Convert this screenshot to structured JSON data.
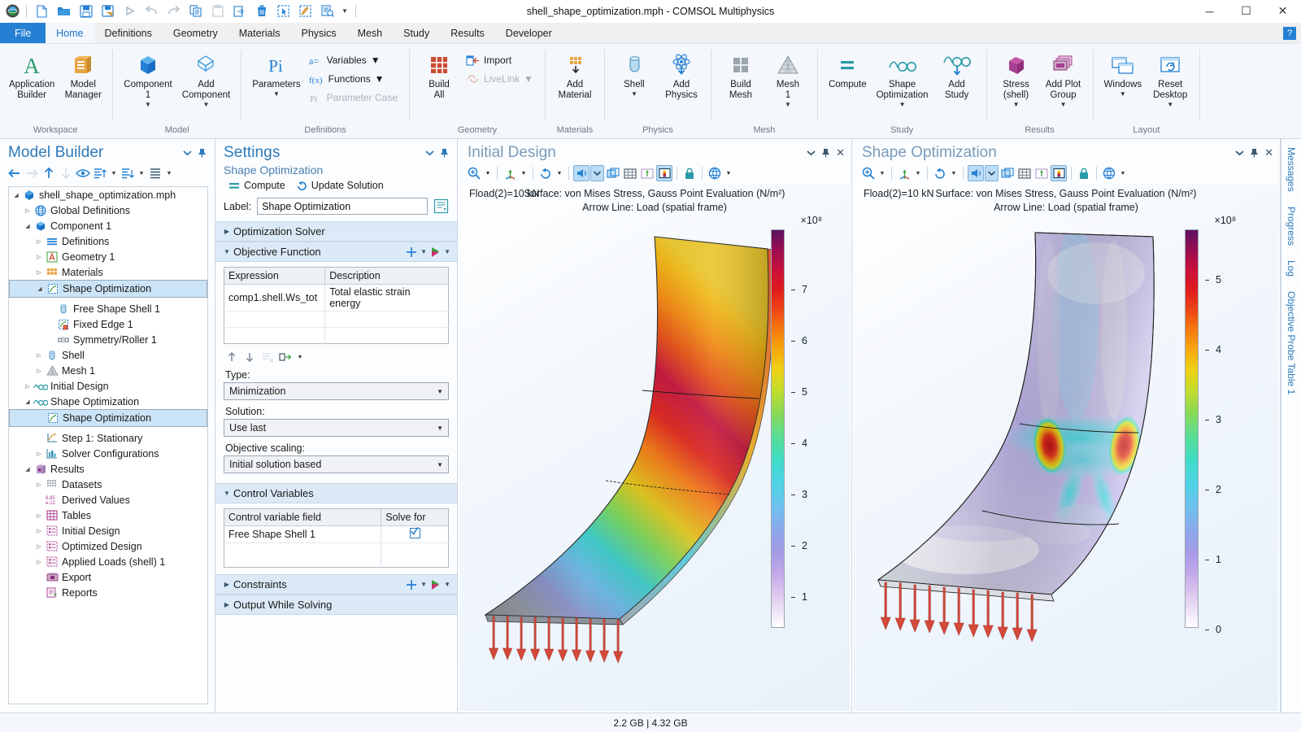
{
  "window": {
    "title": "shell_shape_optimization.mph - COMSOL Multiphysics",
    "minimize": "─",
    "maximize": "☐",
    "close": "✕",
    "help_badge": "?"
  },
  "quick_access": [
    {
      "name": "new-file-icon",
      "tip": "New"
    },
    {
      "name": "open-folder-icon",
      "tip": "Open"
    },
    {
      "name": "save-icon",
      "tip": "Save"
    },
    {
      "name": "save-as-icon",
      "tip": "Save As"
    },
    {
      "name": "run-icon",
      "tip": "Compute"
    },
    {
      "name": "undo-icon",
      "tip": "Undo"
    },
    {
      "name": "redo-icon",
      "tip": "Redo"
    },
    {
      "name": "copy-icon",
      "tip": "Copy"
    },
    {
      "name": "paste-icon",
      "tip": "Paste"
    },
    {
      "name": "duplicate-icon",
      "tip": "Duplicate"
    },
    {
      "name": "delete-icon",
      "tip": "Delete"
    },
    {
      "name": "select-box-icon",
      "tip": "Select Box"
    },
    {
      "name": "select-brush-icon",
      "tip": "Select Brush"
    },
    {
      "name": "zoom-report-icon",
      "tip": "Zoom"
    }
  ],
  "tabs": [
    {
      "label": "File",
      "kind": "file"
    },
    {
      "label": "Home",
      "kind": "active"
    },
    {
      "label": "Definitions",
      "kind": "normal"
    },
    {
      "label": "Geometry",
      "kind": "normal"
    },
    {
      "label": "Materials",
      "kind": "normal"
    },
    {
      "label": "Physics",
      "kind": "normal"
    },
    {
      "label": "Mesh",
      "kind": "normal"
    },
    {
      "label": "Study",
      "kind": "normal"
    },
    {
      "label": "Results",
      "kind": "normal"
    },
    {
      "label": "Developer",
      "kind": "normal"
    }
  ],
  "ribbon": {
    "groups": [
      {
        "title": "Workspace",
        "buttons": [
          {
            "label": "Application\nBuilder",
            "icon": "application-builder-icon",
            "dropdown": false
          },
          {
            "label": "Model\nManager",
            "icon": "model-manager-icon",
            "dropdown": false
          }
        ]
      },
      {
        "title": "Model",
        "buttons": [
          {
            "label": "Component\n1",
            "icon": "component-cube-icon",
            "dropdown": true
          },
          {
            "label": "Add\nComponent",
            "icon": "add-component-icon",
            "dropdown": true
          }
        ]
      },
      {
        "title": "Definitions",
        "buttons": [
          {
            "label": "Parameters",
            "icon": "parameters-pi-icon",
            "dropdown": true
          }
        ],
        "small": [
          {
            "label": "Variables",
            "icon": "variables-icon",
            "dropdown": true,
            "disabled": false
          },
          {
            "label": "Functions",
            "icon": "functions-icon",
            "dropdown": true,
            "disabled": false
          },
          {
            "label": "Parameter Case",
            "icon": "parameter-case-icon",
            "dropdown": false,
            "disabled": true
          }
        ]
      },
      {
        "title": "Geometry",
        "buttons": [
          {
            "label": "Build\nAll",
            "icon": "build-all-icon",
            "dropdown": false
          }
        ],
        "small": [
          {
            "label": "Import",
            "icon": "import-icon",
            "dropdown": false,
            "disabled": false
          },
          {
            "label": "LiveLink",
            "icon": "livelink-icon",
            "dropdown": true,
            "disabled": true
          }
        ]
      },
      {
        "title": "Materials",
        "buttons": [
          {
            "label": "Add\nMaterial",
            "icon": "add-material-icon",
            "dropdown": false
          }
        ]
      },
      {
        "title": "Physics",
        "buttons": [
          {
            "label": "Shell",
            "icon": "shell-icon",
            "dropdown": true
          },
          {
            "label": "Add\nPhysics",
            "icon": "add-physics-icon",
            "dropdown": false
          }
        ]
      },
      {
        "title": "Mesh",
        "buttons": [
          {
            "label": "Build\nMesh",
            "icon": "build-mesh-icon",
            "dropdown": false
          },
          {
            "label": "Mesh\n1",
            "icon": "mesh-triangle-icon",
            "dropdown": true
          }
        ]
      },
      {
        "title": "Study",
        "buttons": [
          {
            "label": "Compute",
            "icon": "compute-equals-icon",
            "dropdown": false
          },
          {
            "label": "Shape\nOptimization",
            "icon": "shape-optimization-icon",
            "dropdown": true
          },
          {
            "label": "Add\nStudy",
            "icon": "add-study-icon",
            "dropdown": false
          }
        ]
      },
      {
        "title": "Results",
        "buttons": [
          {
            "label": "Stress\n(shell)",
            "icon": "stress-shell-icon",
            "dropdown": true
          },
          {
            "label": "Add Plot\nGroup",
            "icon": "add-plot-group-icon",
            "dropdown": true
          }
        ]
      },
      {
        "title": "Layout",
        "buttons": [
          {
            "label": "Windows",
            "icon": "windows-icon",
            "dropdown": true
          },
          {
            "label": "Reset\nDesktop",
            "icon": "reset-desktop-icon",
            "dropdown": true
          }
        ]
      }
    ]
  },
  "model_builder": {
    "title": "Model Builder",
    "toolbar": [
      {
        "name": "back-arrow-icon",
        "disabled": false
      },
      {
        "name": "forward-arrow-icon",
        "disabled": true
      },
      {
        "name": "move-up-icon",
        "disabled": false
      },
      {
        "name": "move-down-icon",
        "disabled": true
      },
      {
        "name": "show-hide-icon",
        "disabled": false
      },
      {
        "name": "expand-all-icon",
        "disabled": false
      },
      {
        "name": "collapse-all-icon",
        "disabled": false
      },
      {
        "name": "tree-options-icon",
        "disabled": false
      }
    ],
    "tree": [
      {
        "label": "shell_shape_optimization.mph",
        "indent": 0,
        "arrow": "down",
        "icon": "model-file-icon",
        "selected": false
      },
      {
        "label": "Global Definitions",
        "indent": 1,
        "arrow": "right",
        "icon": "globe-icon",
        "selected": false
      },
      {
        "label": "Component 1",
        "indent": 1,
        "arrow": "down",
        "icon": "component-icon",
        "selected": false
      },
      {
        "label": "Definitions",
        "indent": 2,
        "arrow": "right",
        "icon": "definitions-icon",
        "selected": false
      },
      {
        "label": "Geometry 1",
        "indent": 2,
        "arrow": "right",
        "icon": "geometry-icon",
        "selected": false
      },
      {
        "label": "Materials",
        "indent": 2,
        "arrow": "right",
        "icon": "materials-icon",
        "selected": false
      },
      {
        "label": "Shape Optimization",
        "indent": 2,
        "arrow": "down",
        "icon": "shape-opt-physics-icon",
        "selected": true
      },
      {
        "label": "Free Shape Shell 1",
        "indent": 3,
        "arrow": "none",
        "icon": "free-shape-shell-icon",
        "selected": false
      },
      {
        "label": "Fixed Edge 1",
        "indent": 3,
        "arrow": "none",
        "icon": "fixed-edge-icon",
        "selected": false
      },
      {
        "label": "Symmetry/Roller 1",
        "indent": 3,
        "arrow": "none",
        "icon": "symmetry-roller-icon",
        "selected": false
      },
      {
        "label": "Shell",
        "indent": 2,
        "arrow": "right",
        "icon": "shell-physics-icon",
        "selected": false
      },
      {
        "label": "Mesh 1",
        "indent": 2,
        "arrow": "right",
        "icon": "mesh-icon",
        "selected": false
      },
      {
        "label": "Initial Design",
        "indent": 1,
        "arrow": "right",
        "icon": "study-icon",
        "selected": false
      },
      {
        "label": "Shape Optimization",
        "indent": 1,
        "arrow": "down",
        "icon": "study-icon",
        "selected": false
      },
      {
        "label": "Shape Optimization",
        "indent": 2,
        "arrow": "none",
        "icon": "shape-opt-physics-icon",
        "selected": true
      },
      {
        "label": "Step 1: Stationary",
        "indent": 2,
        "arrow": "none",
        "icon": "stationary-step-icon",
        "selected": false
      },
      {
        "label": "Solver Configurations",
        "indent": 2,
        "arrow": "right",
        "icon": "solver-config-icon",
        "selected": false
      },
      {
        "label": "Results",
        "indent": 1,
        "arrow": "down",
        "icon": "results-icon",
        "selected": false
      },
      {
        "label": "Datasets",
        "indent": 2,
        "arrow": "right",
        "icon": "datasets-icon",
        "selected": false
      },
      {
        "label": "Derived Values",
        "indent": 2,
        "arrow": "none",
        "icon": "derived-values-icon",
        "selected": false
      },
      {
        "label": "Tables",
        "indent": 2,
        "arrow": "right",
        "icon": "tables-icon",
        "selected": false
      },
      {
        "label": "Initial Design",
        "indent": 2,
        "arrow": "right",
        "icon": "plot-group-icon",
        "selected": false
      },
      {
        "label": "Optimized Design",
        "indent": 2,
        "arrow": "right",
        "icon": "plot-group-icon",
        "selected": false
      },
      {
        "label": "Applied Loads (shell) 1",
        "indent": 2,
        "arrow": "right",
        "icon": "plot-group-icon",
        "selected": false
      },
      {
        "label": "Export",
        "indent": 2,
        "arrow": "none",
        "icon": "export-icon",
        "selected": false
      },
      {
        "label": "Reports",
        "indent": 2,
        "arrow": "none",
        "icon": "reports-icon",
        "selected": false
      }
    ]
  },
  "settings": {
    "title": "Settings",
    "subtitle": "Shape Optimization",
    "actions": [
      {
        "label": "Compute",
        "icon": "compute-equals-icon"
      },
      {
        "label": "Update Solution",
        "icon": "update-solution-icon"
      }
    ],
    "label_field": {
      "label": "Label:",
      "value": "Shape Optimization"
    },
    "sections": [
      {
        "title": "Optimization Solver",
        "expanded": false
      },
      {
        "title": "Objective Function",
        "expanded": true
      },
      {
        "title": "Control Variables",
        "expanded": true
      },
      {
        "title": "Constraints",
        "expanded": false
      },
      {
        "title": "Output While Solving",
        "expanded": false
      }
    ],
    "objective_table": {
      "headers": [
        "Expression",
        "Description"
      ],
      "rows": [
        [
          "comp1.shell.Ws_tot",
          "Total elastic strain energy"
        ]
      ]
    },
    "fields": [
      {
        "label": "Type:",
        "value": "Minimization"
      },
      {
        "label": "Solution:",
        "value": "Use last"
      },
      {
        "label": "Objective scaling:",
        "value": "Initial solution based"
      }
    ],
    "control_table": {
      "headers": [
        "Control variable field",
        "Solve for"
      ],
      "rows": [
        [
          "Free Shape Shell 1",
          "checked"
        ]
      ]
    }
  },
  "graphics": [
    {
      "title": "Initial Design",
      "load_label": "Fload(2)=10 kN",
      "caption_line1": "Surface: von Mises Stress, Gauss Point Evaluation (N/m²)",
      "caption_line2": "Arrow Line: Load (spatial frame)",
      "colorbar": {
        "exponent": "×10⁸",
        "ticks": [
          "7",
          "6",
          "5",
          "4",
          "3",
          "2",
          "1"
        ],
        "max": 7.8,
        "min": 0
      }
    },
    {
      "title": "Shape Optimization",
      "load_label": "Fload(2)=10 kN",
      "caption_line1": "Surface: von Mises Stress, Gauss Point Evaluation (N/m²)",
      "caption_line2": "Arrow Line: Load (spatial frame)",
      "colorbar": {
        "exponent": "×10⁸",
        "ticks": [
          "5",
          "4",
          "3",
          "2",
          "1",
          "0"
        ],
        "max": 5.7,
        "min": 0
      }
    }
  ],
  "graphics_toolbar": [
    {
      "name": "zoom-icon",
      "dropdown": true,
      "active": false
    },
    {
      "name": "axis-orientation-icon",
      "dropdown": true,
      "active": false
    },
    {
      "name": "rotate-icon",
      "dropdown": true,
      "active": false
    },
    {
      "name": "render-mode-icon",
      "dropdown": true,
      "active": true
    },
    {
      "name": "transparency-icon",
      "dropdown": false,
      "active": false
    },
    {
      "name": "grid-icon",
      "dropdown": false,
      "active": false
    },
    {
      "name": "show-axis-icon",
      "dropdown": false,
      "active": false
    },
    {
      "name": "color-legend-icon",
      "dropdown": false,
      "active": true
    },
    {
      "name": "lock-icon",
      "dropdown": false,
      "active": false
    },
    {
      "name": "scene-light-icon",
      "dropdown": true,
      "active": false
    }
  ],
  "right_dock": {
    "tabs": [
      "Messages",
      "Progress",
      "Log",
      "Objective Probe Table 1"
    ]
  },
  "status": {
    "memory": "2.2 GB | 4.32 GB"
  },
  "colors": {
    "accent": "#2580d4",
    "panel_title": "#2e7ab8",
    "section_header": "#dceaf7",
    "selection": "#cce4f7",
    "arrow_red": "#cf4a3c"
  }
}
